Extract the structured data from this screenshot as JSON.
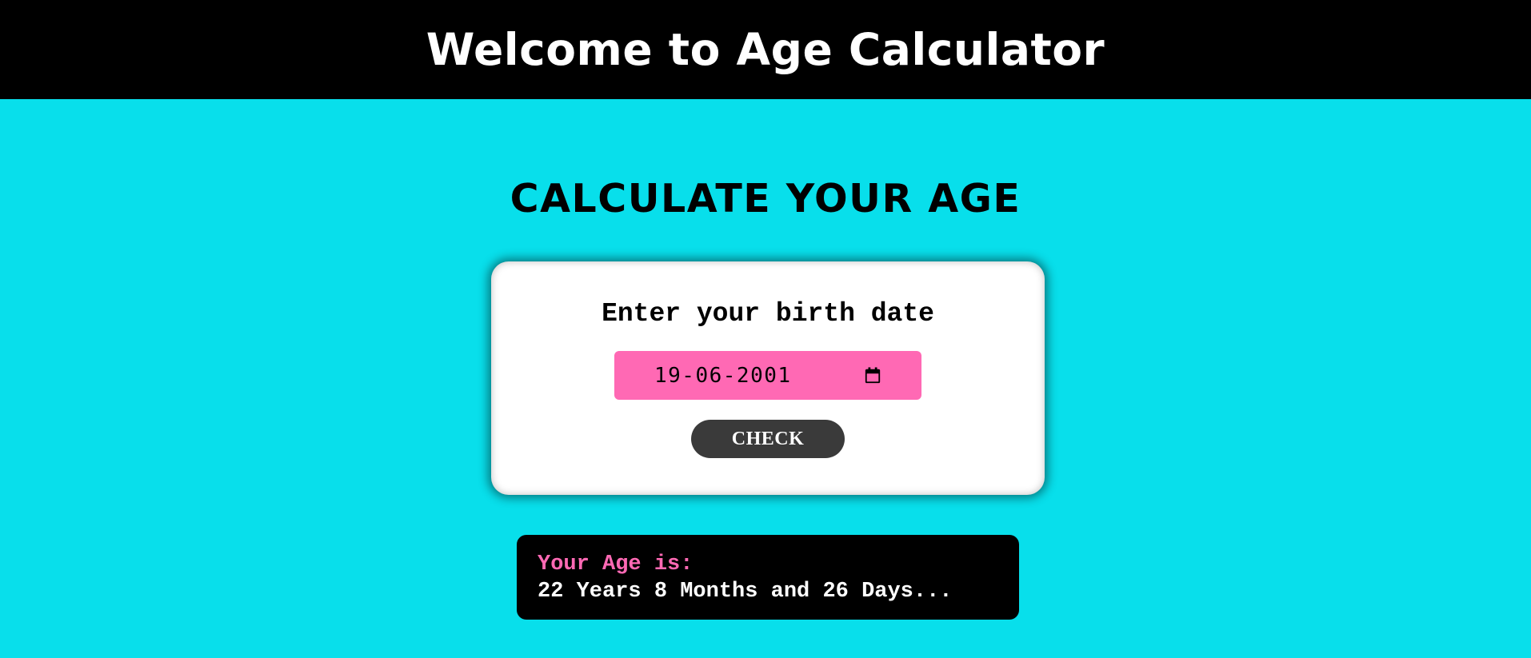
{
  "header": {
    "title": "Welcome to Age Calculator"
  },
  "main": {
    "title": "CALCULATE YOUR AGE"
  },
  "form": {
    "label": "Enter your birth date",
    "date_value": "19-06-2001",
    "check_label": "CHECK"
  },
  "result": {
    "label": "Your Age is:",
    "value": "22 Years 8 Months and 26 Days..."
  },
  "colors": {
    "background": "#08dfeb",
    "header": "#000000",
    "input": "#ff69b4",
    "button": "#3a3a3a",
    "result_label": "#ff69b4"
  },
  "icons": {
    "date_picker": "calendar-icon"
  }
}
